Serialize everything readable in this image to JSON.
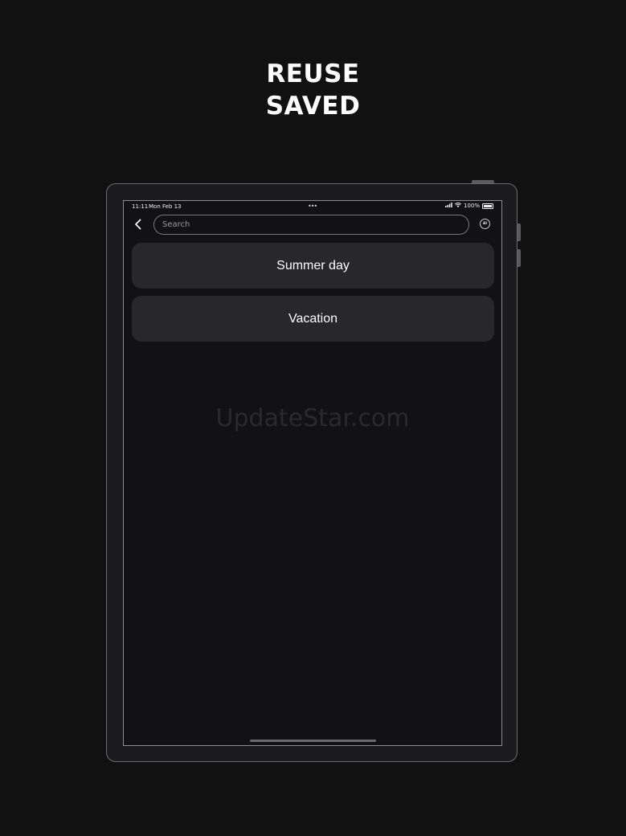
{
  "headline": {
    "line1": "REUSE",
    "line2": "SAVED"
  },
  "status_bar": {
    "time": "11:11",
    "date": "Mon Feb 13",
    "dots": "•••",
    "battery": "100%",
    "icons": [
      "signal-icon",
      "wifi-icon",
      "battery-icon"
    ]
  },
  "nav": {
    "back_icon": "chevron-left-icon",
    "search_placeholder": "Search",
    "search_value": "",
    "ai_label": "AI"
  },
  "saved_items": [
    {
      "label": "Summer day"
    },
    {
      "label": "Vacation"
    }
  ],
  "watermark": "UpdateStar.com",
  "colors": {
    "background": "#111112",
    "screen": "#121215",
    "card": "#27272c",
    "text": "#ffffff"
  }
}
